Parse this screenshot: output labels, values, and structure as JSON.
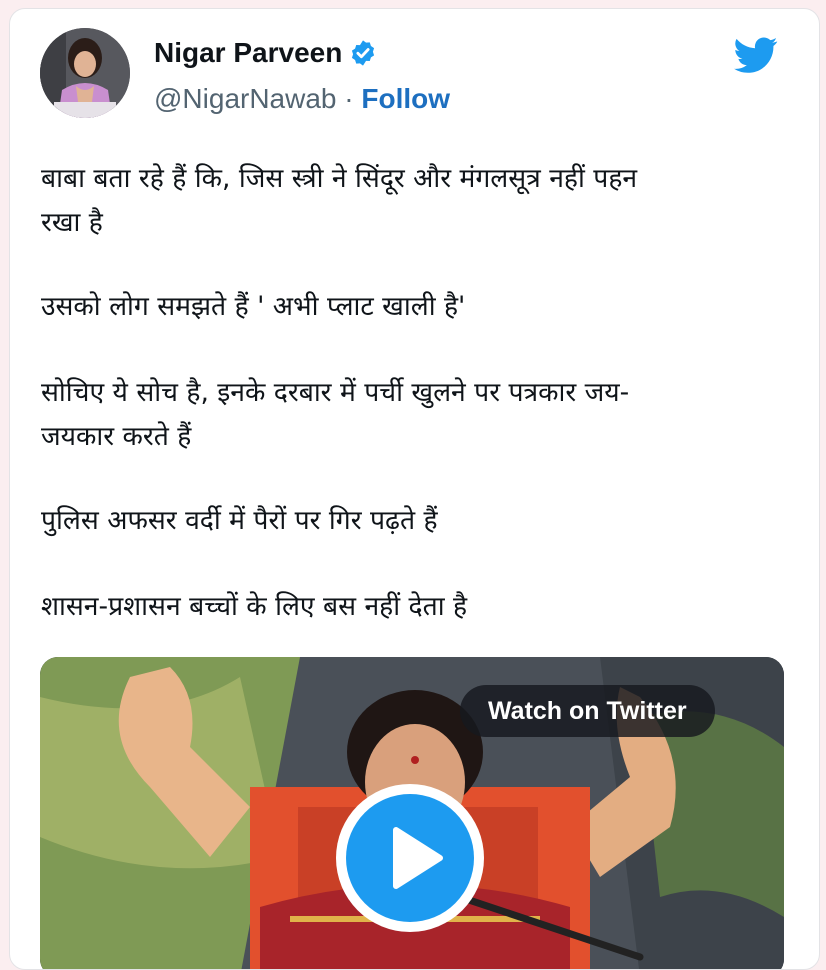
{
  "tweet": {
    "author": {
      "name": "Nigar Parveen",
      "handle": "@NigarNawab",
      "separator": "·",
      "follow_label": "Follow",
      "verified": true
    },
    "text_lines": [
      "बाबा बता रहे हैं कि, जिस स्त्री ने सिंदूर और मंगलसूत्र नहीं पहन",
      "रखा है",
      "उसको लोग समझते हैं ' अभी प्लाट खाली है'",
      "सोचिए ये सोच है, इनके दरबार में पर्ची खुलने पर पत्रकार जय-",
      "जयकार करते हैं",
      "पुलिस अफसर वर्दी में पैरों पर गिर पढ़ते हैं",
      "शासन-प्रशासन बच्चों के लिए बस नहीं देता है"
    ],
    "media": {
      "watch_label": "Watch on Twitter",
      "play_icon": "play-icon"
    }
  },
  "colors": {
    "twitter_blue": "#1d9bf0",
    "follow_blue": "#1d6fc0",
    "text": "#0f1419",
    "secondary_text": "#536471",
    "page_background": "#fbeef0"
  }
}
